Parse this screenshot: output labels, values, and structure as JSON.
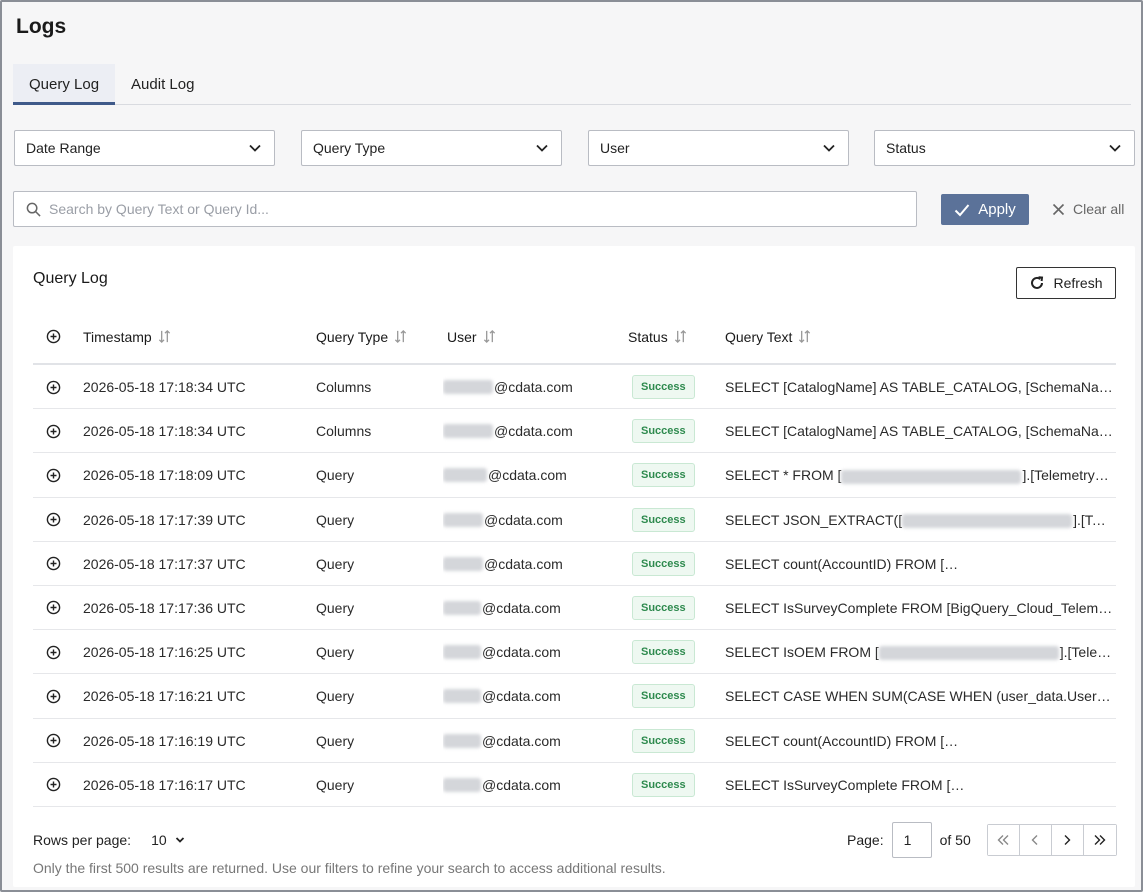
{
  "page": {
    "title": "Logs"
  },
  "tabs": [
    {
      "label": "Query Log",
      "active": true
    },
    {
      "label": "Audit Log",
      "active": false
    }
  ],
  "filters": [
    {
      "label": "Date Range"
    },
    {
      "label": "Query Type"
    },
    {
      "label": "User"
    },
    {
      "label": "Status"
    }
  ],
  "search": {
    "placeholder": "Search by Query Text or Query Id...",
    "value": ""
  },
  "actions": {
    "apply_label": "Apply",
    "clear_label": "Clear all"
  },
  "panel": {
    "title": "Query Log",
    "refresh_label": "Refresh",
    "columns": [
      "Timestamp",
      "Query Type",
      "User",
      "Status",
      "Query Text"
    ],
    "rows": [
      {
        "timestamp": "2026-05-18 17:18:34 UTC",
        "type": "Columns",
        "user": "@cdata.com",
        "status": "Success",
        "query": "SELECT [CatalogName] AS TABLE_CATALOG, [SchemaName] AS TABLE_SCHEMA"
      },
      {
        "timestamp": "2026-05-18 17:18:34 UTC",
        "type": "Columns",
        "user": "@cdata.com",
        "status": "Success",
        "query": "SELECT [CatalogName] AS TABLE_CATALOG, [SchemaName] AS TABLE_SCHEMA"
      },
      {
        "timestamp": "2026-05-18 17:18:09 UTC",
        "type": "Query",
        "user": "@cdata.com",
        "status": "Success",
        "query_pre": "SELECT * FROM [",
        "query_post": "].[TelemetryC..."
      },
      {
        "timestamp": "2026-05-18 17:17:39 UTC",
        "type": "Query",
        "user": "@cdata.com",
        "status": "Success",
        "query_pre": "SELECT JSON_EXTRACT([",
        "query_post": "].[Tel..."
      },
      {
        "timestamp": "2026-05-18 17:17:37 UTC",
        "type": "Query",
        "user": "@cdata.com",
        "status": "Success",
        "query_pre": "SELECT count(AccountID) FROM [",
        "query_post": "..."
      },
      {
        "timestamp": "2026-05-18 17:17:36 UTC",
        "type": "Query",
        "user": "@cdata.com",
        "status": "Success",
        "query": "SELECT IsSurveyComplete FROM [BigQuery_Cloud_Telemetry]"
      },
      {
        "timestamp": "2026-05-18 17:16:25 UTC",
        "type": "Query",
        "user": "@cdata.com",
        "status": "Success",
        "query_pre": "SELECT IsOEM FROM [",
        "query_post": "].[Teleme..."
      },
      {
        "timestamp": "2026-05-18 17:16:21 UTC",
        "type": "Query",
        "user": "@cdata.com",
        "status": "Success",
        "query": "SELECT CASE WHEN SUM(CASE WHEN (user_data.UserAgent"
      },
      {
        "timestamp": "2026-05-18 17:16:19 UTC",
        "type": "Query",
        "user": "@cdata.com",
        "status": "Success",
        "query_pre": "SELECT count(AccountID) FROM [",
        "query_post": "..."
      },
      {
        "timestamp": "2026-05-18 17:16:17 UTC",
        "type": "Query",
        "user": "@cdata.com",
        "status": "Success",
        "query_pre": "SELECT IsSurveyComplete FROM [",
        "query_post": "e..."
      }
    ]
  },
  "footer": {
    "rows_per_page_label": "Rows per page:",
    "rows_per_page_value": "10",
    "note": "Only the first 500 results are returned. Use our filters to refine your search to access additional results.",
    "page_label": "Page:",
    "page_value": "1",
    "page_total": "of 50"
  },
  "colors": {
    "accent": "#5b7299",
    "tab_indicator": "#3f5a8a",
    "success": "#2e8a4e"
  },
  "icons": [
    "chevron-down-icon",
    "search-icon",
    "check-icon",
    "close-icon",
    "refresh-icon",
    "sort-icon",
    "plus-circle-icon",
    "first-page-icon",
    "prev-page-icon",
    "next-page-icon",
    "last-page-icon"
  ]
}
